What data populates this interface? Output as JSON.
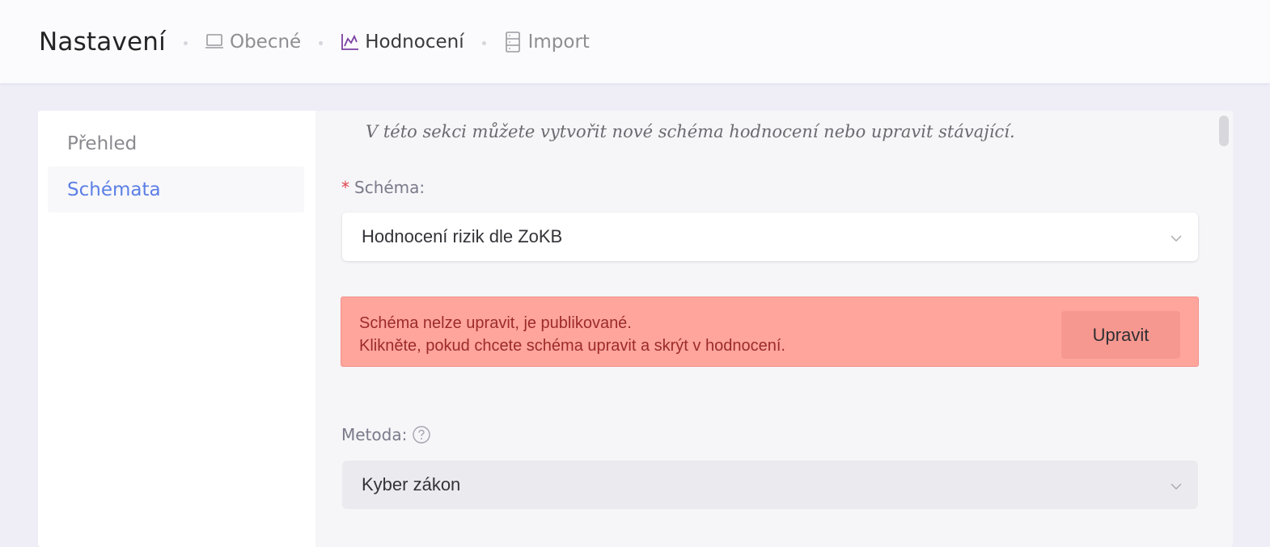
{
  "header": {
    "title": "Nastavení",
    "breadcrumbs": [
      {
        "label": "Obecné",
        "icon": "laptop-icon",
        "active": false
      },
      {
        "label": "Hodnocení",
        "icon": "line-chart-icon",
        "active": true
      },
      {
        "label": "Import",
        "icon": "server-icon",
        "active": false
      }
    ]
  },
  "sidebar": {
    "items": [
      {
        "label": "Přehled",
        "active": false
      },
      {
        "label": "Schémata",
        "active": true
      }
    ]
  },
  "main": {
    "intro": "V této sekci můžete vytvořit nové schéma hodnocení nebo upravit stávající.",
    "schema_field": {
      "required_mark": "*",
      "label": "Schéma:",
      "value": "Hodnocení rizik dle ZoKB"
    },
    "alert": {
      "line1": "Schéma nelze upravit, je publikované.",
      "line2": "Klikněte, pokud chcete schéma upravit a skrýt v hodnocení.",
      "button_label": "Upravit"
    },
    "method_field": {
      "label": "Metoda:",
      "value": "Kyber zákon"
    }
  },
  "colors": {
    "accent_blue": "#5b7fe6",
    "active_chart_purple": "#7b3fa0",
    "alert_bg": "#ffa59c",
    "alert_text": "#9c2b2b",
    "required_red": "#e0414a"
  }
}
